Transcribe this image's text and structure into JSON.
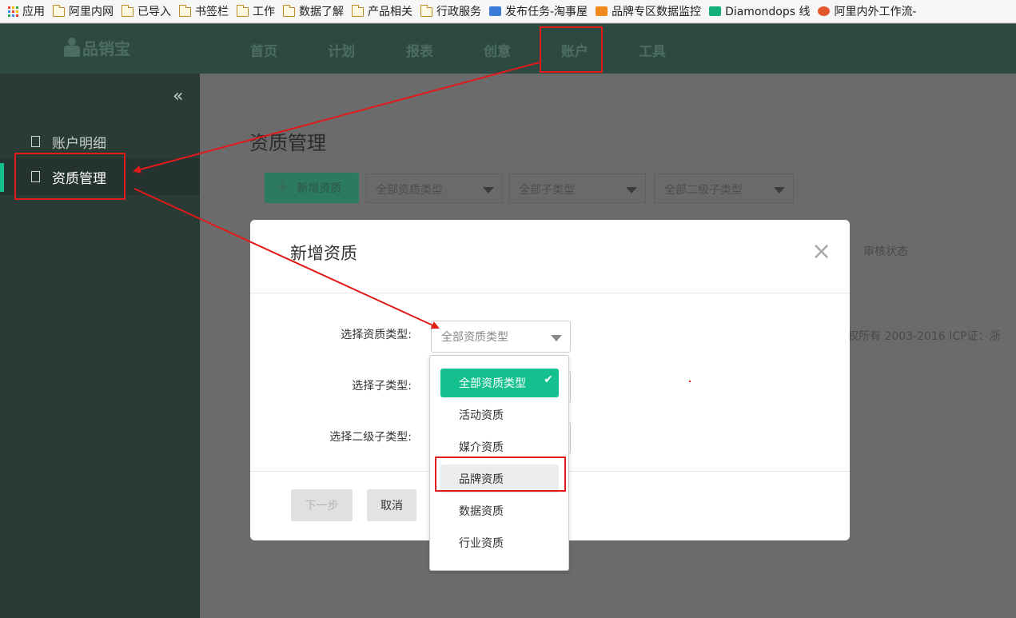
{
  "bookmarks": [
    {
      "label": "应用",
      "icon": "apps-grid-icon"
    },
    {
      "label": "阿里内网",
      "icon": "folder-icon"
    },
    {
      "label": "已导入",
      "icon": "folder-icon"
    },
    {
      "label": "书签栏",
      "icon": "folder-icon"
    },
    {
      "label": "工作",
      "icon": "folder-icon"
    },
    {
      "label": "数据了解",
      "icon": "folder-icon"
    },
    {
      "label": "产品相关",
      "icon": "folder-icon"
    },
    {
      "label": "行政服务",
      "icon": "folder-icon"
    },
    {
      "label": "发布任务-淘事屋",
      "icon": "house-icon"
    },
    {
      "label": "品牌专区数据监控",
      "icon": "site-icon"
    },
    {
      "label": "Diamondops 线",
      "icon": "diamond-site-icon"
    },
    {
      "label": "阿里内外工作流-",
      "icon": "star-site-icon"
    }
  ],
  "header": {
    "logo": "品销宝",
    "nav": [
      "首页",
      "计划",
      "报表",
      "创意",
      "账户",
      "工具"
    ],
    "active_nav": "账户"
  },
  "sidebar": {
    "collapse_icon": "double-chevron-left-icon",
    "items": [
      {
        "label": "账户明细",
        "active": false
      },
      {
        "label": "资质管理",
        "active": true
      }
    ]
  },
  "main": {
    "page_title": "资质管理",
    "add_button": "新增资质",
    "filters": [
      "全部资质类型",
      "全部子类型",
      "全部二级子类型"
    ],
    "table_header_status": "审核状态",
    "footer_text": "权所有 2003-2016    ICP证：浙"
  },
  "modal": {
    "title": "新增资质",
    "close_icon": "close-icon",
    "fields": [
      {
        "label": "选择资质类型:",
        "value": "全部资质类型"
      },
      {
        "label": "选择子类型:",
        "value": ""
      },
      {
        "label": "选择二级子类型:",
        "value": ""
      }
    ],
    "next_button": "下一步",
    "cancel_button": "取消"
  },
  "dropdown": {
    "options": [
      "全部资质类型",
      "活动资质",
      "媒介资质",
      "品牌资质",
      "数据资质",
      "行业资质"
    ],
    "selected": "全部资质类型",
    "highlighted": "品牌资质"
  },
  "colors": {
    "accent": "#13c08e",
    "header_bg": "#2c4a41",
    "sidebar_bg": "#2a3a35",
    "annotation_red": "#e11a1a"
  }
}
